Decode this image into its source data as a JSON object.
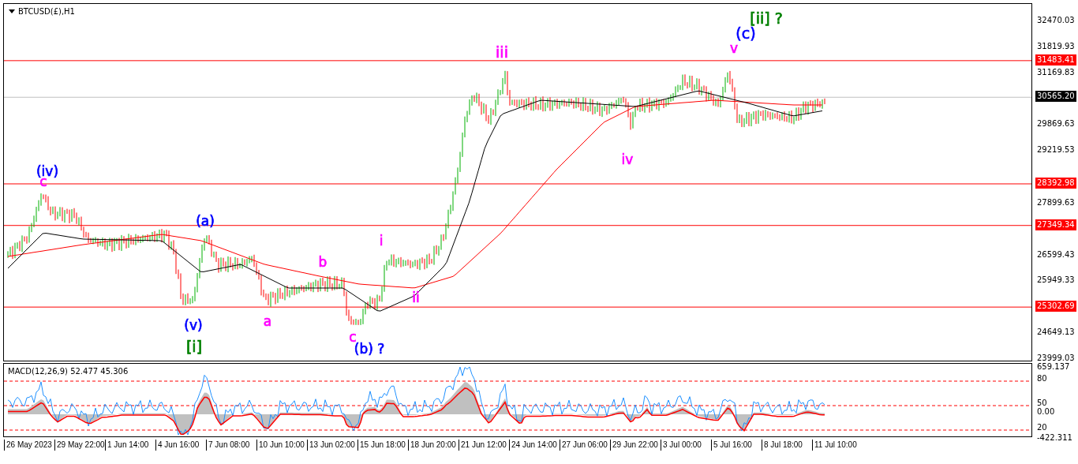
{
  "chart": {
    "symbol": "BTCUSD(£),H1",
    "price_axis": [
      "32470.03",
      "31819.93",
      "31169.83",
      "29869.63",
      "29219.53",
      "27899.63",
      "26599.43",
      "25949.33",
      "24649.13",
      "23999.03"
    ],
    "levels": [
      {
        "label": "31483.41",
        "kind": "line"
      },
      {
        "label": "30565.20",
        "kind": "current"
      },
      {
        "label": "28392.98",
        "kind": "line"
      },
      {
        "label": "27349.34",
        "kind": "line"
      },
      {
        "label": "25302.69",
        "kind": "line"
      }
    ],
    "wave_labels": [
      {
        "text": "(iv)",
        "color": "#0000ff"
      },
      {
        "text": "c",
        "color": "#ff00ff"
      },
      {
        "text": "(a)",
        "color": "#0000ff"
      },
      {
        "text": "(v)",
        "color": "#0000ff"
      },
      {
        "text": "[i]",
        "color": "#008000"
      },
      {
        "text": "a",
        "color": "#ff00ff"
      },
      {
        "text": "b",
        "color": "#ff00ff"
      },
      {
        "text": "i",
        "color": "#ff00ff"
      },
      {
        "text": "ii",
        "color": "#ff00ff"
      },
      {
        "text": "c",
        "color": "#ff00ff"
      },
      {
        "text": "(b) ?",
        "color": "#0000ff"
      },
      {
        "text": "iii",
        "color": "#ff00ff"
      },
      {
        "text": "iv",
        "color": "#ff00ff"
      },
      {
        "text": "v",
        "color": "#ff00ff"
      },
      {
        "text": "(c)",
        "color": "#0000ff"
      },
      {
        "text": "[ii] ?",
        "color": "#008000"
      }
    ]
  },
  "macd": {
    "title": "MACD(12,26,9) 52.477 45.306",
    "axis": [
      "659.137",
      "80",
      "50",
      "0.00",
      "20",
      "-422.311"
    ]
  },
  "time_axis": [
    "26 May 2023",
    "29 May 22:00",
    "1 Jun 14:00",
    "4 Jun 16:00",
    "7 Jun 08:00",
    "10 Jun 10:00",
    "13 Jun 02:00",
    "15 Jun 18:00",
    "18 Jun 20:00",
    "21 Jun 12:00",
    "24 Jun 14:00",
    "27 Jun 06:00",
    "29 Jun 22:00",
    "3 Jul 00:00",
    "5 Jul 16:00",
    "8 Jul 18:00",
    "11 Jul 10:00"
  ]
}
